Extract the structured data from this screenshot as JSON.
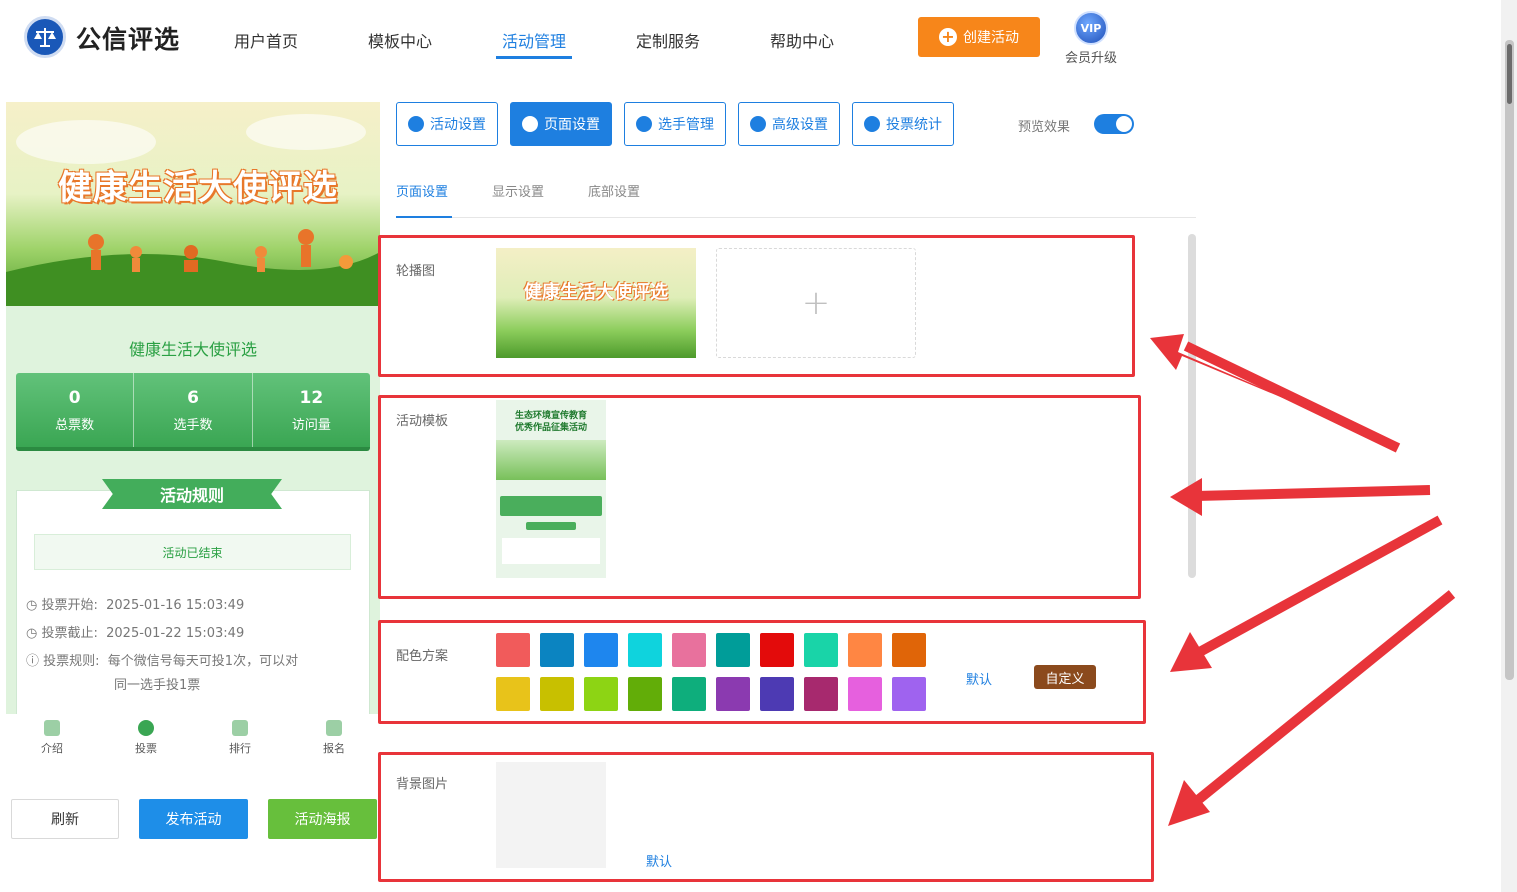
{
  "brand": {
    "name": "公信评选"
  },
  "nav": {
    "items": [
      {
        "label": "用户首页"
      },
      {
        "label": "模板中心"
      },
      {
        "label": "活动管理"
      },
      {
        "label": "定制服务"
      },
      {
        "label": "帮助中心"
      }
    ],
    "active": "活动管理",
    "create_label": "创建活动",
    "vip_badge": "VIP",
    "vip_label": "会员升级"
  },
  "preview": {
    "banner_title": "健康生活大使评选",
    "title": "健康生活大使评选",
    "stats": [
      {
        "value": "0",
        "label": "总票数"
      },
      {
        "value": "6",
        "label": "选手数"
      },
      {
        "value": "12",
        "label": "访问量"
      }
    ],
    "rules_title": "活动规则",
    "ended_text": "活动已结束",
    "vote_start_label": "投票开始:",
    "vote_start": "2025-01-16 15:03:49",
    "vote_end_label": "投票截止:",
    "vote_end": "2025-01-22 15:03:49",
    "rule_label": "投票规则:",
    "rule_text_1": "每个微信号每天可投1次，可以对",
    "rule_text_2": "同一选手投1票",
    "tabs": [
      {
        "label": "介绍"
      },
      {
        "label": "投票"
      },
      {
        "label": "排行"
      },
      {
        "label": "报名"
      }
    ]
  },
  "bottom_buttons": {
    "refresh": "刷新",
    "publish": "发布活动",
    "poster": "活动海报"
  },
  "settings_tabs": [
    {
      "label": "活动设置"
    },
    {
      "label": "页面设置"
    },
    {
      "label": "选手管理"
    },
    {
      "label": "高级设置"
    },
    {
      "label": "投票统计"
    }
  ],
  "preview_toggle": {
    "label": "预览效果",
    "on": true
  },
  "sub_tabs": [
    {
      "label": "页面设置"
    },
    {
      "label": "显示设置"
    },
    {
      "label": "底部设置"
    }
  ],
  "sections": {
    "carousel": {
      "label": "轮播图",
      "image_text": "健康生活大使评选",
      "add": "+"
    },
    "template": {
      "label": "活动模板",
      "thumb_title_1": "生态环境宣传教育",
      "thumb_title_2": "优秀作品征集活动"
    },
    "colors": {
      "label": "配色方案",
      "row1": [
        "#f15b5b",
        "#0b84c1",
        "#1e86ee",
        "#0fd3dd",
        "#e8719d",
        "#009d99",
        "#e30b0b",
        "#19d4a8",
        "#ff8643",
        "#e06508"
      ],
      "row2": [
        "#e8c31a",
        "#c8c000",
        "#8dd414",
        "#62ad08",
        "#0eae7c",
        "#8b3ab0",
        "#4d3ab3",
        "#a7296e",
        "#e660de",
        "#9f63ef"
      ],
      "default_label": "默认",
      "custom_label": "自定义"
    },
    "background": {
      "label": "背景图片",
      "default_label": "默认"
    }
  }
}
